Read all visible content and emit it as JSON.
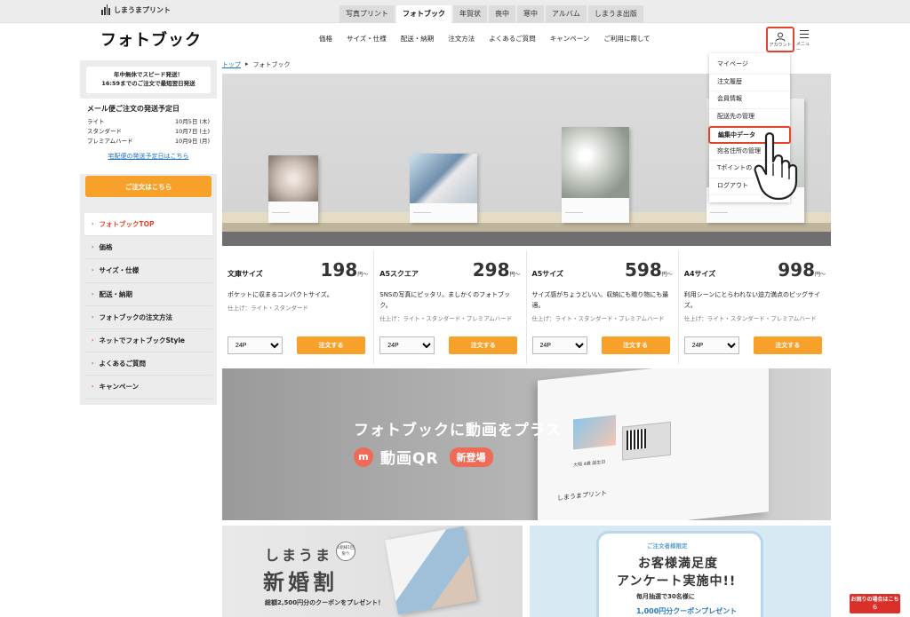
{
  "brand": {
    "name": "しまうまプリント"
  },
  "site_tabs": [
    {
      "label": "写真プリント"
    },
    {
      "label": "フォトブック"
    },
    {
      "label": "年賀状"
    },
    {
      "label": "喪中"
    },
    {
      "label": "寒中"
    },
    {
      "label": "アルバム"
    },
    {
      "label": "しまうま出版"
    }
  ],
  "header": {
    "title": "フォトブック",
    "nav": [
      "価格",
      "サイズ・仕様",
      "配送・納期",
      "注文方法",
      "よくあるご質問",
      "キャンペーン",
      "ご利用に際して"
    ],
    "account_label": "アカウント",
    "menu_label": "メニュー"
  },
  "account_menu": {
    "items": [
      "マイページ",
      "注文履歴",
      "会員情報",
      "配送先の管理",
      "編集中データ",
      "宛名住所の管理",
      "Tポイントの",
      "ログアウト"
    ],
    "highlighted": "編集中データ"
  },
  "sidebar": {
    "notice_line1": "年中無休でスピード発送！",
    "notice_line2": "16:59までのご注文で最短翌日発送",
    "schedule_title": "メール便ご注文の発送予定日",
    "schedule": [
      {
        "plan": "ライト",
        "date": "10月5日 (木)"
      },
      {
        "plan": "スタンダード",
        "date": "10月7日 (土)"
      },
      {
        "plan": "プレミアムハード",
        "date": "10月9日 (月)"
      }
    ],
    "schedule_link": "宅配便の発送予定日はこちら",
    "order_button": "ご注文はこちら",
    "nav": [
      "フォトブックTOP",
      "価格",
      "サイズ・仕様",
      "配送・納期",
      "フォトブックの注文方法",
      "ネットでフォトブックStyle",
      "よくあるご質問",
      "キャンペーン"
    ],
    "active_nav": "フォトブックTOP"
  },
  "breadcrumb": {
    "home": "トップ",
    "separator": "▸",
    "current": "フォトブック"
  },
  "products": [
    {
      "name": "文庫サイズ",
      "price": "198",
      "unit": "円〜",
      "desc": "ポケットに収まるコンパクトサイズ。",
      "finish": "仕上げ：ライト・スタンダード",
      "pages": "24P",
      "buy": "注文する"
    },
    {
      "name": "A5スクエア",
      "price": "298",
      "unit": "円〜",
      "desc": "SNSの写真にピッタリ。ましかくのフォトブック。",
      "finish": "仕上げ：ライト・スタンダード・プレミアムハード",
      "pages": "24P",
      "buy": "注文する"
    },
    {
      "name": "A5サイズ",
      "price": "598",
      "unit": "円〜",
      "desc": "サイズ感がちょうどいい。収納にも贈り物にも最適。",
      "finish": "仕上げ：ライト・スタンダード・プレミアムハード",
      "pages": "24P",
      "buy": "注文する"
    },
    {
      "name": "A4サイズ",
      "price": "998",
      "unit": "円〜",
      "desc": "利用シーンにとらわれない迫力満点のビッグサイズ。",
      "finish": "仕上げ：ライト・スタンダード・プレミアムハード",
      "pages": "24P",
      "buy": "注文する"
    }
  ],
  "qr_banner": {
    "title": "フォトブックに動画をプラス",
    "mark": "m",
    "subtitle": "動画QR",
    "badge": "新登場",
    "page_logo": "しまうまプリント",
    "page_caption": "大翔 4歳 誕生日"
  },
  "banner_left": {
    "line1": "しまうま",
    "line2": "新婚割",
    "badge": "1組様1回限り",
    "note": "総額2,500円分のクーポンをプレゼント！"
  },
  "banner_right": {
    "tag": "ご注文者様限定",
    "line1": "お客様満足度",
    "line2": "アンケート実施中!!",
    "line3": "毎月抽選で30名様に",
    "line4": "1,000円分クーポンプレゼント"
  },
  "help_button": "お困りの場合はこちら",
  "colors": {
    "accent": "#f7a12a",
    "highlight": "#e3432c",
    "link": "#1a6fc2"
  }
}
